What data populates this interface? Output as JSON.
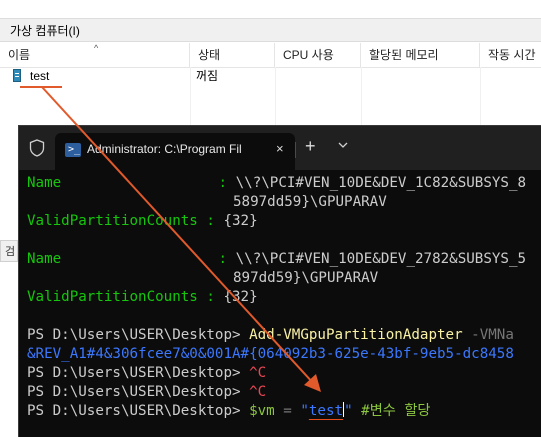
{
  "vm_panel": {
    "title": "가상 컴퓨터(I)",
    "columns": [
      "이름",
      "상태",
      "CPU 사용",
      "할당된 메모리",
      "작동 시간"
    ],
    "rows": [
      {
        "name": "test",
        "state": "꺼짐"
      }
    ],
    "lower_tab_fragment": "검"
  },
  "terminal": {
    "tab_title": "Administrator: C:\\Program Fil",
    "close_symbol": "×",
    "new_tab_symbol": "+",
    "lines": {
      "l1_label": "Name",
      "l1_sep": " : ",
      "l1_val": "\\\\?\\PCI#VEN_10DE&DEV_1C82&SUBSYS_8",
      "l2_val": "5897dd59}\\GPUPARAV",
      "l3_label": "ValidPartitionCounts",
      "l3_sep": " : ",
      "l3_val": "{32}",
      "l4_label": "Name",
      "l4_sep": " : ",
      "l4_val": "\\\\?\\PCI#VEN_10DE&DEV_2782&SUBSYS_5",
      "l5_val": "897dd59}\\GPUPARAV",
      "l6_label": "ValidPartitionCounts",
      "l6_sep": " : ",
      "l6_val": "{32}",
      "prompt": "PS D:\\Users\\USER\\Desktop> ",
      "cmd1": "Add-VMGpuPartitionAdapter",
      "cmd1_param": " -VMNa",
      "cmd1_cont": "&REV_A1#4&306fcee7&0&001A#{064092b3-625e-43bf-9eb5-dc8458",
      "ctrlc": "^C",
      "var": "$vm",
      "eq": " = ",
      "q_open": "\"",
      "str_val": "test",
      "q_close": "\"",
      "comment": " #변수 할당"
    }
  },
  "annotation": {
    "arrow_color": "#e05a2b"
  }
}
